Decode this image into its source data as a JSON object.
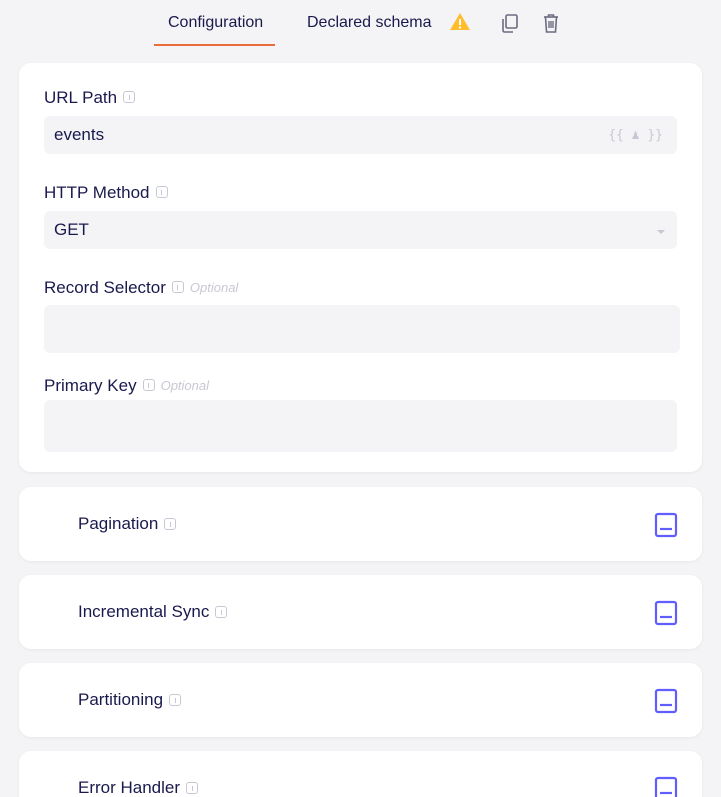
{
  "tabs": [
    {
      "label": "Configuration",
      "active": true
    },
    {
      "label": "Declared schema",
      "active": false,
      "warning": true
    }
  ],
  "toolbar": {
    "copy_icon": "copy-icon",
    "delete_icon": "trash-icon"
  },
  "form": {
    "url_path": {
      "label": "URL Path",
      "value": "events",
      "action_icon": "user-variable-icon"
    },
    "http_method": {
      "label": "HTTP Method",
      "value": "GET"
    },
    "record_selector": {
      "label": "Record Selector",
      "optional": "Optional",
      "value": ""
    },
    "primary_key": {
      "label": "Primary Key",
      "optional": "Optional",
      "value": ""
    }
  },
  "sections": [
    {
      "label": "Pagination",
      "icon": "book-icon"
    },
    {
      "label": "Incremental Sync",
      "icon": "book-icon"
    },
    {
      "label": "Partitioning",
      "icon": "book-icon"
    },
    {
      "label": "Error Handler",
      "icon": "book-icon"
    }
  ],
  "colors": {
    "accent": "#e96d3a",
    "doc_icon": "#615eff",
    "warning": "#ffbd2e",
    "text": "#1a194d"
  }
}
